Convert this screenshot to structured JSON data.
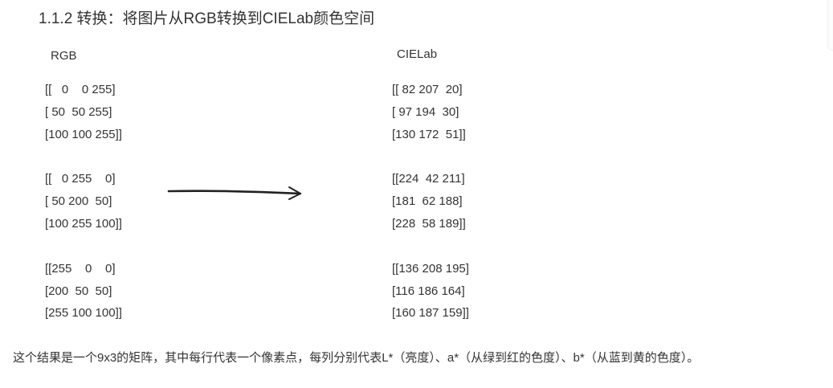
{
  "heading": "1.1.2 转换：将图片从RGB转换到CIELab颜色空间",
  "rgb_label": "RGB",
  "lab_label": "CIELab",
  "rgb_blocks": [
    [
      "[[   0    0 255]",
      "[ 50  50 255]",
      "[100 100 255]]"
    ],
    [
      "[[   0 255    0]",
      "[ 50 200  50]",
      "[100 255 100]]"
    ],
    [
      "[[255    0    0]",
      "[200  50  50]",
      "[255 100 100]]"
    ]
  ],
  "lab_blocks": [
    [
      "[[ 82 207  20]",
      "[ 97 194  30]",
      "[130 172  51]]"
    ],
    [
      "[[224  42 211]",
      "[181  62 188]",
      "[228  58 189]]"
    ],
    [
      "[[136 208 195]",
      "[116 186 164]",
      "[160 187 159]]"
    ]
  ],
  "summary": "这个结果是一个9x3的矩阵，其中每行代表一个像素点，每列分别代表L*（亮度）、a*（从绿到红的色度）、b*（从蓝到黄的色度）。",
  "arrow_color": "#222222"
}
